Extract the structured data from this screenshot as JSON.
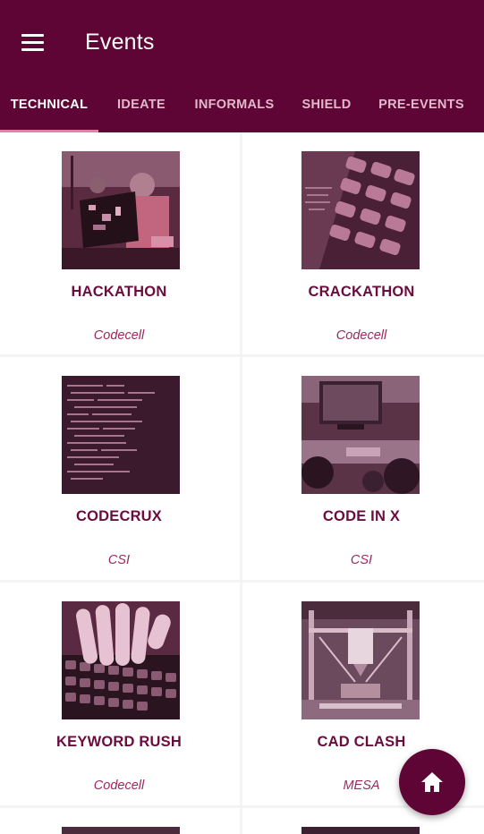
{
  "header": {
    "title": "Events",
    "menu_icon": "hamburger-menu-icon",
    "bg_color": "#5e0535"
  },
  "tabs": [
    {
      "label": "TECHNICAL",
      "active": true
    },
    {
      "label": "IDEATE",
      "active": false
    },
    {
      "label": "INFORMALS",
      "active": false
    },
    {
      "label": "SHIELD",
      "active": false
    },
    {
      "label": "PRE-EVENTS",
      "active": false
    }
  ],
  "events": [
    {
      "name": "HACKATHON",
      "organizer": "Codecell",
      "image": "person-with-laptop"
    },
    {
      "name": "CRACKATHON",
      "organizer": "Codecell",
      "image": "keyboard-closeup"
    },
    {
      "name": "CODECRUX",
      "organizer": "CSI",
      "image": "code-screen"
    },
    {
      "name": "CODE IN X",
      "organizer": "CSI",
      "image": "people-at-computer"
    },
    {
      "name": "KEYWORD RUSH",
      "organizer": "Codecell",
      "image": "hands-typing"
    },
    {
      "name": "CAD CLASH",
      "organizer": "MESA",
      "image": "3d-printer"
    }
  ],
  "fab": {
    "icon": "home-icon"
  },
  "colors": {
    "accent": "#5e0535",
    "event_title": "#6a0d3e",
    "organizer": "#9a2a61",
    "tab_indicator": "#e57fa6"
  }
}
